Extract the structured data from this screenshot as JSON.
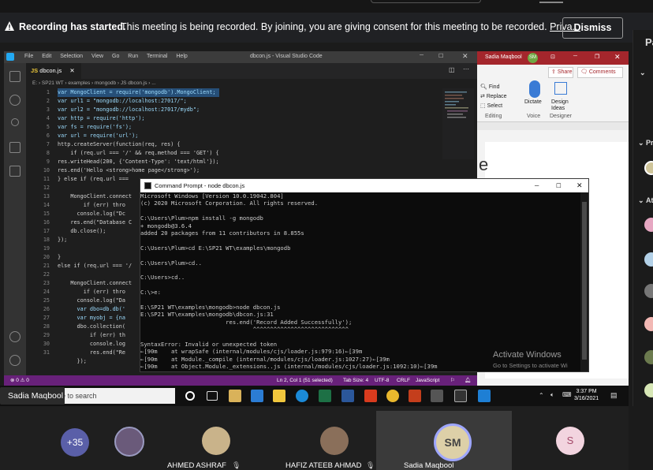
{
  "banner": {
    "title": "Recording has started.",
    "message": "This meeting is being recorded. By joining, you are giving consent for this meeting to be recorded.",
    "privacy_link": "Priva...",
    "dismiss_label": "Dismiss"
  },
  "vscode": {
    "window_title": "dbcon.js - Visual Studio Code",
    "menu": [
      "File",
      "Edit",
      "Selection",
      "View",
      "Go",
      "Run",
      "Terminal",
      "Help"
    ],
    "tab_label": "dbcon.js",
    "tab_badge": "JS",
    "breadcrumb": "E: › SP21 WT › examples › mongodb › JS dbcon.js › ...",
    "line_numbers": [
      "1",
      "2",
      "3",
      "4",
      "5",
      "6",
      "7",
      "8",
      "9",
      "10",
      "11",
      "12",
      "13",
      "14",
      "15",
      "16",
      "17",
      "18",
      "19",
      "20",
      "21",
      "22",
      "23",
      "24",
      "25",
      "26",
      "27",
      "28",
      "29",
      "30",
      "31"
    ],
    "code_lines": [
      "var MongoClient = require('mongodb').MongoClient;",
      "var url1 = \"mongodb://localhost:27017/\";",
      "var url2 = \"mongodb://localhost:27017/mydb\";",
      "var http = require('http');",
      "var fs = require('fs');",
      "var url = require('url');",
      "http.createServer(function(req, res) {",
      "    if (req.url === '/' && req.method === 'GET') {",
      "res.writeHead(200, {'Content-Type': 'text/html'});",
      "res.end('Hello <strong>home page</strong>');",
      "} else if (req.url ===",
      "",
      "    MongoClient.connect",
      "        if (err) thro",
      "      console.log(\"Dc",
      "    res.end(\"Database C",
      "    db.close();",
      "});",
      "",
      "}",
      "else if (req.url === '/",
      "",
      "    MongoClient.connect",
      "        if (err) thro",
      "      console.log(\"Da",
      "      var dbo=db.db('",
      "      var myobj = {na",
      "      dbo.collection(",
      "          if (err) th",
      "          console.log",
      "          res.end(\"Re",
      "      });"
    ],
    "status_left": "⊗ 0 ⚠ 0",
    "status_right": [
      "Ln 2, Col 1 (51 selected)",
      "Tab Size: 4",
      "UTF-8",
      "CRLF",
      "JavaScript"
    ]
  },
  "word": {
    "user": "Sadia Maqbool",
    "user_initials": "SM",
    "share_label": "Share",
    "comments_label": "Comments",
    "find_label": "Find",
    "replace_label": "Replace",
    "select_label": "Select",
    "editing_label": "Editing",
    "dictate_label": "Dictate",
    "voice_label": "Voice",
    "design_ideas_label": "Design Ideas",
    "designer_label": "Designer",
    "page_letter": "e"
  },
  "cmd": {
    "title": "Command Prompt - node dbcon.js",
    "lines": [
      "Microsoft Windows [Version 10.0.19042.804]",
      "(c) 2020 Microsoft Corporation. All rights reserved.",
      "",
      "C:\\Users\\Plum>npm install -g mongodb",
      "+ mongodb@3.6.4",
      "added 20 packages from 11 contributors in 8.855s",
      "",
      "C:\\Users\\Plum>cd E:\\SP21 WT\\examples\\mongodb",
      "",
      "C:\\Users\\Plum>cd..",
      "",
      "C:\\Users>cd..",
      "",
      "C:\\>e:",
      "",
      "E:\\SP21 WT\\examples\\mongodb>node dbcon.js",
      "E:\\SP21 WT\\examples\\mongodb\\dbcon.js:31",
      "                         res.end('Record Added Successfully');",
      "                                 ^^^^^^^^^^^^^^^^^^^^^^^^^^^^",
      "",
      "SyntaxError: Invalid or unexpected token",
      "←[90m    at wrapSafe (internal/modules/cjs/loader.js:979:16)←[39m",
      "←[90m    at Module._compile (internal/modules/cjs/loader.js:1027:27)←[39m",
      "←[90m    at Object.Module._extensions..js (internal/modules/cjs/loader.js:1092:10)←[39m"
    ]
  },
  "activate": {
    "title": "Activate Windows",
    "subtitle": "Go to Settings to activate Wi"
  },
  "taskbar": {
    "search_text": "e to search",
    "time": "3:37 PM",
    "date": "3/16/2021"
  },
  "presenter_name": "Sadia Maqbool",
  "right_panel": {
    "label1": "Pa",
    "label2": "Pr",
    "label3": "At"
  },
  "participants": {
    "more_count": "+35",
    "people": [
      {
        "name": "AHMED ASHRAF"
      },
      {
        "name": "HAFIZ ATEEB AHMAD"
      },
      {
        "name": "Sadia Maqbool",
        "initials": "SM"
      },
      {
        "initials": "S"
      }
    ]
  },
  "colors": {
    "vscode_status": "#68217a",
    "word_title": "#a4262c",
    "sm_avatar": "#ddd0a8",
    "s_avatar": "#f2d4df",
    "more_avatar": "#5a5fa8"
  }
}
